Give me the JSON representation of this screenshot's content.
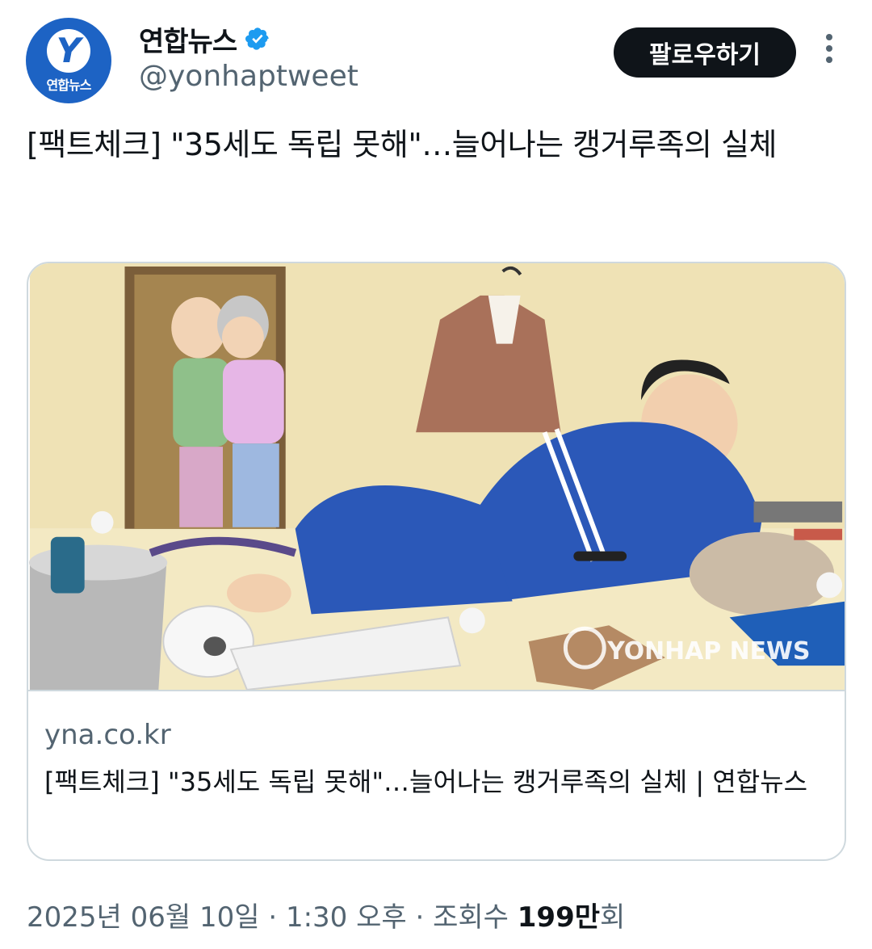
{
  "author": {
    "display_name": "연합뉴스",
    "handle": "@yonhaptweet",
    "avatar_text": "연합뉴스",
    "avatar_mark": "Y",
    "verified": true
  },
  "actions": {
    "follow_label": "팔로우하기"
  },
  "tweet": {
    "text": "[팩트체크] \"35세도 독립 못해\"…늘어나는 캥거루족의 실체"
  },
  "card": {
    "image_watermark": "YONHAP NEWS",
    "domain": "yna.co.kr",
    "title": "[팩트체크] \"35세도 독립 못해\"…늘어나는 캥거루족의 실체 | 연합뉴스"
  },
  "meta": {
    "date": "2025년 06월 10일",
    "separator": "·",
    "time": "1:30 오후",
    "views_label": "조회수",
    "views_value": "199만",
    "views_suffix": "회"
  },
  "colors": {
    "accent_blue": "#1d9bf0",
    "brand_blue": "#1d63c4",
    "follow_bg": "#0f1419",
    "secondary_text": "#536471"
  }
}
